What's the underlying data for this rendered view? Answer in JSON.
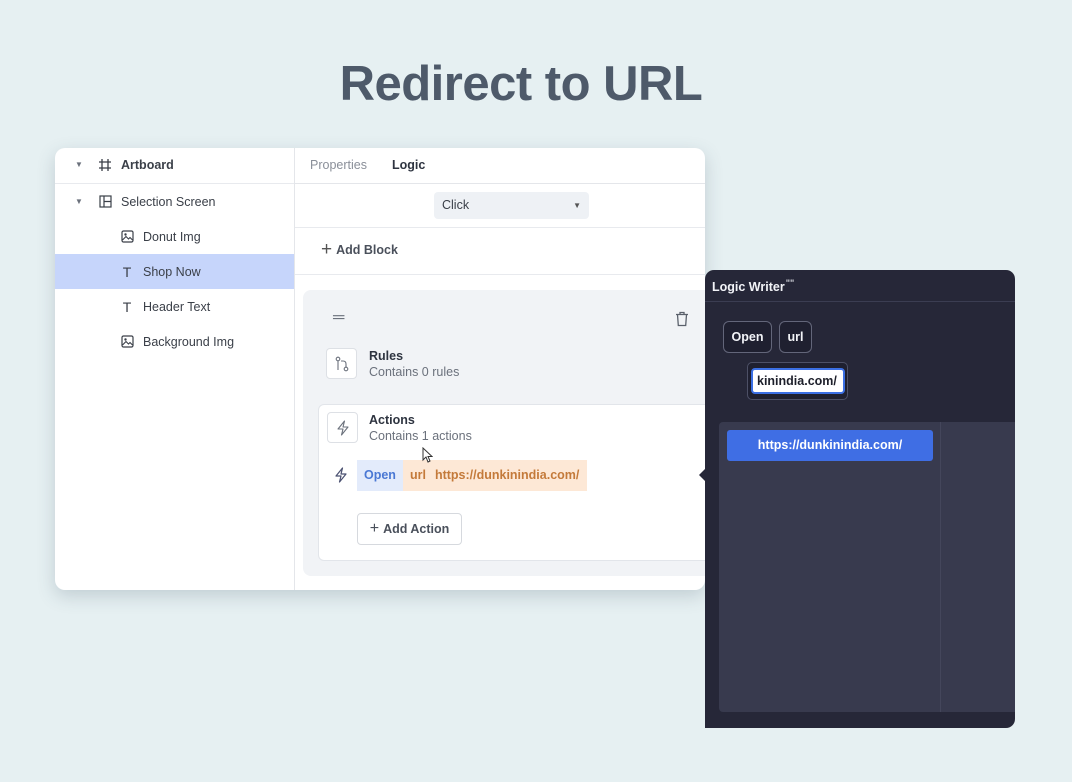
{
  "title": "Redirect to URL",
  "layers": {
    "items": [
      {
        "label": "Artboard",
        "icon": "artboard-icon"
      },
      {
        "label": "Selection Screen",
        "icon": "layout-icon"
      },
      {
        "label": "Donut Img",
        "icon": "image-icon"
      },
      {
        "label": "Shop Now",
        "icon": "text-icon",
        "selected": true
      },
      {
        "label": "Header Text",
        "icon": "text-icon"
      },
      {
        "label": "Background Img",
        "icon": "image-icon"
      }
    ]
  },
  "tabs": [
    "Properties",
    "Logic"
  ],
  "active_tab": "Logic",
  "trigger": {
    "value": "Click"
  },
  "add_block_label": "Add Block",
  "rules": {
    "title": "Rules",
    "subtitle": "Contains 0 rules"
  },
  "actions": {
    "title": "Actions",
    "subtitle": "Contains 1 actions",
    "action": {
      "verb": "Open",
      "param": "url",
      "value": "https://dunkinindia.com/"
    },
    "add_action_label": "Add Action"
  },
  "logic_writer": {
    "title": "Logic Writer",
    "tokens": [
      "Open",
      "url"
    ],
    "input_value": "kinindia.com/",
    "suggestion": "https://dunkinindia.com/"
  },
  "colors": {
    "background": "#e6f0f2",
    "selected_layer": "#c6d5fb",
    "accent_blue": "#3f6ee4",
    "writer_bg": "#262738"
  }
}
